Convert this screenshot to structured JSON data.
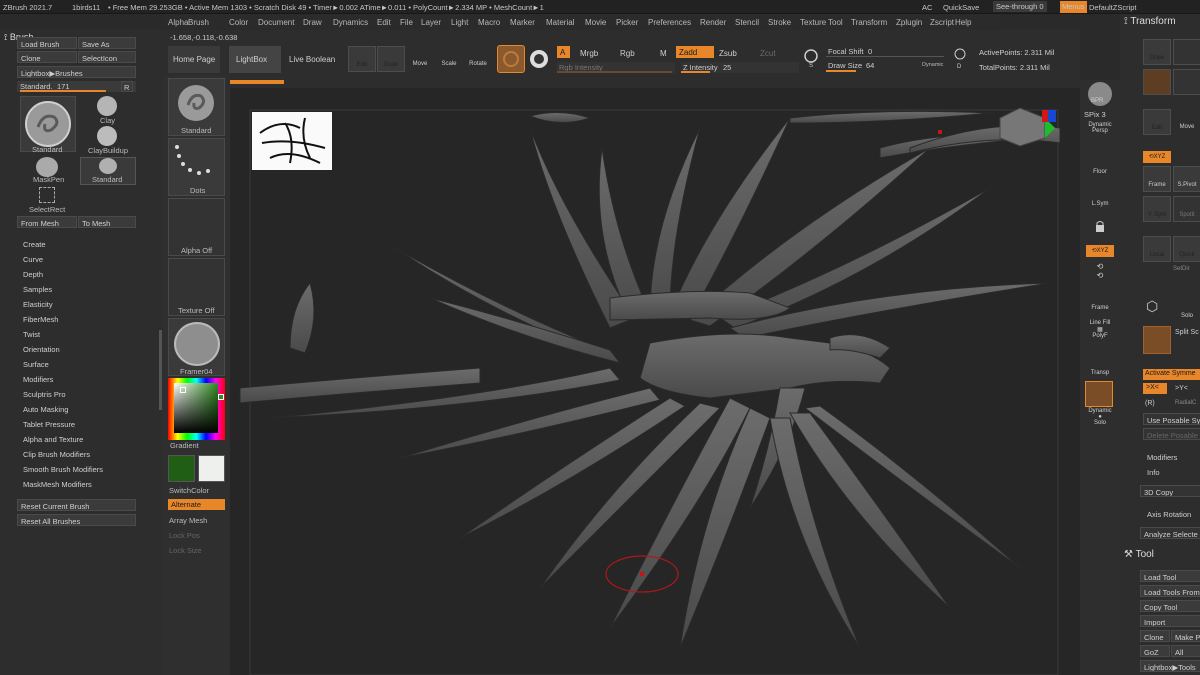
{
  "topbar": {
    "app": "ZBrush 2021.7",
    "doc": "1birds11",
    "stats": "• Free Mem 29.253GB • Active Mem 1303 • Scratch Disk 49 • Timer►0.002 ATime►0.011 • PolyCount►2.334 MP • MeshCount►1",
    "ac": "AC",
    "quicksave": "QuickSave",
    "seethrough": "See-through",
    "seethrough_value": "0",
    "menus": "Menus",
    "script": "DefaultZScript"
  },
  "menu": [
    "Alpha",
    "Brush",
    "Color",
    "Document",
    "Draw",
    "Dynamics",
    "Edit",
    "File",
    "Layer",
    "Light",
    "Macro",
    "Marker",
    "Material",
    "Movie",
    "Picker",
    "Preferences",
    "Render",
    "Stencil",
    "Stroke",
    "Texture",
    "Tool",
    "Transform",
    "Zplugin",
    "Zscript",
    "Help"
  ],
  "brush_panel": {
    "title": "Brush",
    "load": "Load Brush",
    "save": "Save As",
    "clone": "Clone",
    "select_icon": "SelectIcon",
    "lightbox": "Lightbox▶Brushes",
    "standard_label": "Standard.",
    "standard_value": "171",
    "r": "R",
    "brushes": [
      "Standard",
      "Clay",
      "ClayBuildup",
      "MaskPen",
      "Standard",
      "SelectRect"
    ],
    "from_mesh": "From Mesh",
    "to_mesh": "To Mesh",
    "sections": [
      "Create",
      "Curve",
      "Depth",
      "Samples",
      "Elasticity",
      "FiberMesh",
      "Twist",
      "Orientation",
      "Surface",
      "Modifiers",
      "Sculptris Pro",
      "Auto Masking",
      "Tablet Pressure",
      "Alpha and Texture",
      "Clip Brush Modifiers",
      "Smooth Brush Modifiers",
      "MaskMesh Modifiers"
    ],
    "reset_current": "Reset Current Brush",
    "reset_all": "Reset All Brushes"
  },
  "coords": "-1.658,-0.118,-0.638",
  "tabs": [
    "Home Page",
    "LightBox",
    "Live Boolean"
  ],
  "shelf": {
    "standard": "Standard",
    "dots": "Dots",
    "alpha_off": "Alpha Off",
    "texture_off": "Texture Off",
    "material": "Framer04",
    "gradient": "Gradient",
    "switch_color": "SwitchColor",
    "alternate": "Alternate",
    "array_mesh": "Array Mesh",
    "lock_pos": "Lock Pos",
    "lock_size": "Lock Size"
  },
  "toolbar": {
    "edit": "Edit",
    "draw": "Draw",
    "move": "Move",
    "scale": "Scale",
    "rotate": "Rotate",
    "a": "A",
    "mrgb": "Mrgb",
    "rgb": "Rgb",
    "m": "M",
    "zadd": "Zadd",
    "zsub": "Zsub",
    "zcut": "Zcut",
    "rgb_intensity": "Rgb Intensity",
    "z_intensity_label": "Z Intensity",
    "z_intensity": "25",
    "focal_label": "Focal Shift",
    "focal": "0",
    "draw_size_label": "Draw Size",
    "draw_size": "64",
    "dynamic": "Dynamic",
    "active_points": "ActivePoints: 2.311 Mil",
    "total_points": "TotalPoints: 2.311 Mil"
  },
  "rshelf": [
    "BPR",
    "SPix 3",
    "Dynamic",
    "Persp",
    "Floor",
    "L.Sym",
    "Frame",
    "Line Fill",
    "PolyF",
    "Transp",
    "Dynamic",
    "Solo"
  ],
  "rpanel": {
    "transform": "Transform",
    "items": [
      "Draw",
      "Edit",
      "Move",
      "Frame",
      "S.Pivot",
      "Y. Sym",
      "Spotit",
      "Local",
      "Quick",
      "SetDir",
      "Solo",
      "Split Sc"
    ],
    "activate_sym": "Activate Symme",
    "x": ">X<",
    "y": ">Y<",
    "r": "(R)",
    "radial": "RadialC",
    "posable": "Use Posable Syr",
    "delete_posable": "Delete Posable",
    "modifiers": "Modifiers",
    "info": "Info",
    "copy3d": "3D Copy",
    "axis_rotation": "Axis Rotation",
    "analyze": "Analyze Selecte",
    "tool": "Tool",
    "load_tool": "Load Tool",
    "load_tools_from": "Load Tools From",
    "copy_tool": "Copy Tool",
    "import": "Import",
    "clone": "Clone",
    "make": "Make P",
    "goz": "GoZ",
    "all": "All",
    "lightbox_tools": "Lightbox▶Tools"
  },
  "colors": {
    "accent": "#e8862a",
    "main_color": "#1f5e14",
    "secondary_color": "#eef0ee"
  }
}
